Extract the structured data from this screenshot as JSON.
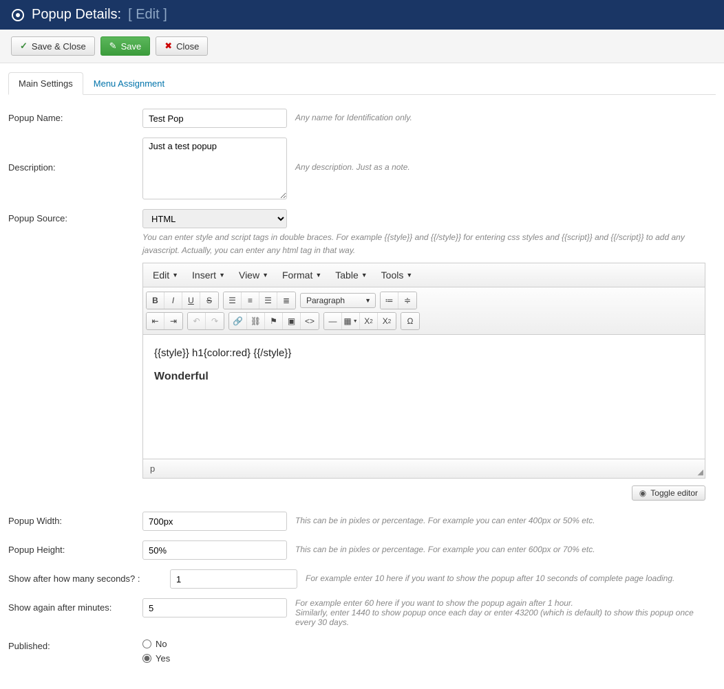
{
  "header": {
    "title": "Popup Details:",
    "edit_text": "[ Edit ]"
  },
  "toolbar": {
    "save_close": "Save & Close",
    "save": "Save",
    "close": "Close"
  },
  "tabs": {
    "main": "Main Settings",
    "menu": "Menu Assignment"
  },
  "fields": {
    "popup_name": {
      "label": "Popup Name:",
      "value": "Test Pop",
      "help": "Any name for Identification only."
    },
    "description": {
      "label": "Description:",
      "value": "Just a test popup",
      "help": "Any description. Just as a note."
    },
    "popup_source": {
      "label": "Popup Source:",
      "value": "HTML",
      "help": "You can enter style and script tags in double braces. For example {{style}} and {{/style}} for entering css styles and {{script}} and {{/script}} to add any javascript. Actually, you can enter any html tag in that way."
    },
    "popup_width": {
      "label": "Popup Width:",
      "value": "700px",
      "help": "This can be in pixles or percentage. For example you can enter 400px or 50% etc."
    },
    "popup_height": {
      "label": "Popup Height:",
      "value": "50%",
      "help": "This can be in pixles or percentage. For example you can enter 600px or 70% etc."
    },
    "show_after": {
      "label": "Show after how many seconds? :",
      "value": "1",
      "help": "For example enter 10 here if you want to show the popup after 10 seconds of complete page loading."
    },
    "show_again": {
      "label": "Show again after minutes:",
      "value": "5",
      "help1": "For example enter 60 here if you want to show the popup again after 1 hour.",
      "help2": "Similarly, enter 1440 to show popup once each day or enter 43200 (which is default) to show this popup once every 30 days."
    },
    "published": {
      "label": "Published:",
      "no": "No",
      "yes": "Yes",
      "value": "yes"
    }
  },
  "editor": {
    "menus": {
      "edit": "Edit",
      "insert": "Insert",
      "view": "View",
      "format": "Format",
      "table": "Table",
      "tools": "Tools"
    },
    "paragraph_label": "Paragraph",
    "content_line1": "{{style}} h1{color:red} {{/style}}",
    "content_line2": "Wonderful",
    "status_path": "p",
    "toggle_label": "Toggle editor"
  }
}
